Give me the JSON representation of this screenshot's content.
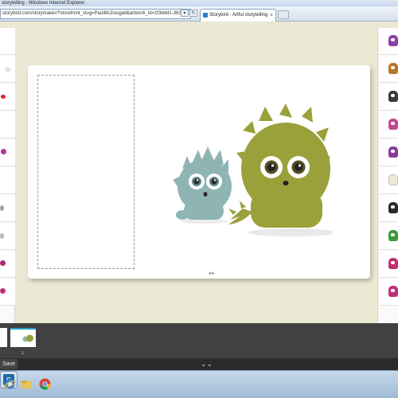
{
  "window": {
    "title": "storytelling - Windows Internet Explorer"
  },
  "address_bar": {
    "url": "storybird.com/storymaker/?storefront_slug=PaulMcDougall&artwork_id=1f3d4d1-3632-47"
  },
  "tabs": [
    {
      "label": "Storybird - Artful storytelling"
    }
  ],
  "page_strip": {
    "page_number": "1"
  },
  "bottom_bar": {
    "save_label": "Save"
  },
  "icons": {
    "resize_handle": "resize-horizontal-icon",
    "collapse": "double-chevron-down-icon",
    "tab_favicon": "storybird-favicon-icon"
  },
  "colors": {
    "canvas_background": "#ebe8d3",
    "page_background": "#ffffff",
    "strip_background": "#414141",
    "accent": "#29a0c8",
    "monster_green": "#9aa03a",
    "monster_blue": "#8fb4b4"
  }
}
